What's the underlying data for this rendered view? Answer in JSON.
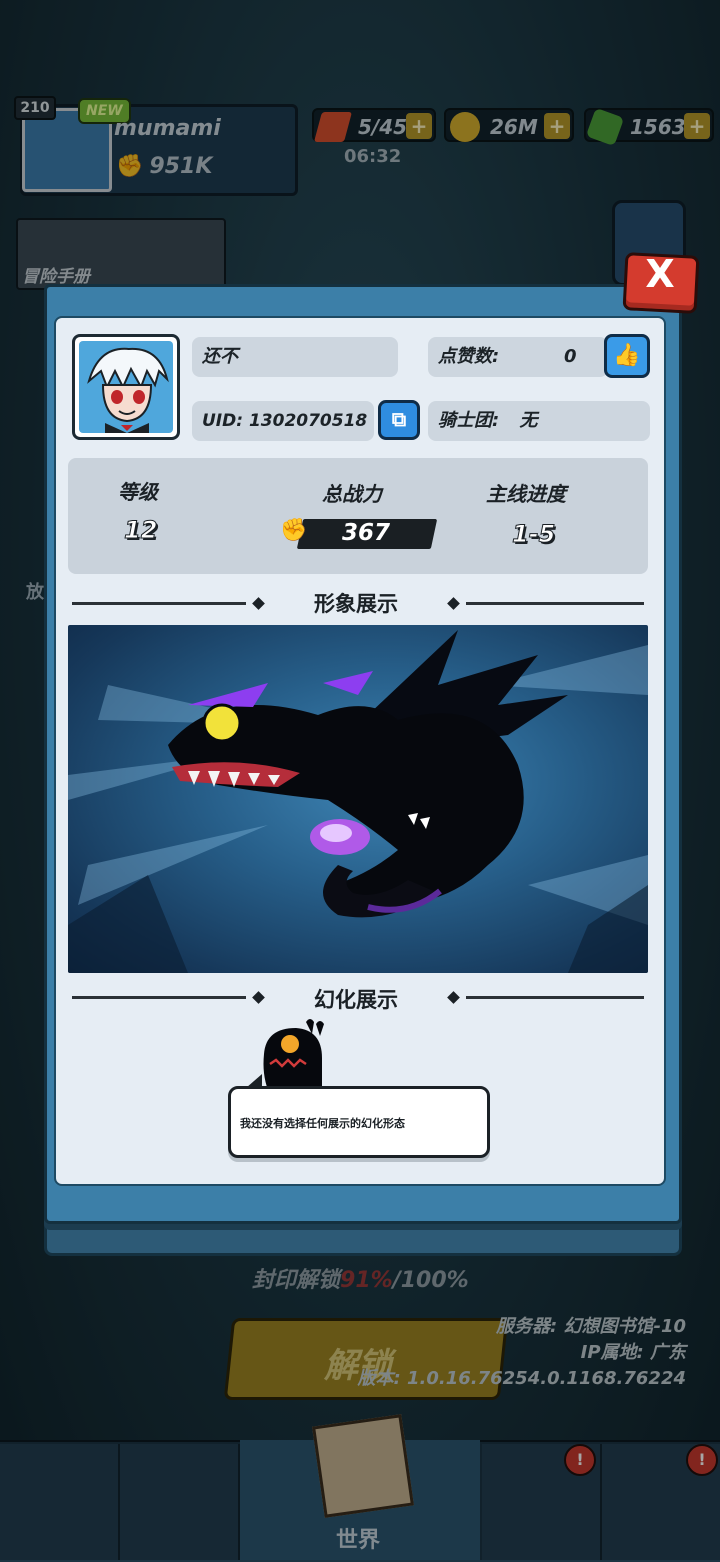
{
  "background": {
    "player": {
      "level": "210",
      "new_badge": "NEW",
      "name": "mumami",
      "power": "951K"
    },
    "resources": {
      "energy": "5/45",
      "energy_timer": "06:32",
      "gold": "26M",
      "gems": "1563"
    },
    "adventure_book": "冒险手册",
    "side_label": "放",
    "seal_unlock": {
      "prefix": "封印解锁",
      "percent": "91%",
      "total": "/100%"
    },
    "unlock_button": "解锁",
    "server_info": {
      "server": "服务器: 幻想图书馆-10",
      "ip": "IP属地: 广东",
      "version": "版本: 1.0.16.76254.0.1168.76224"
    },
    "bottom_nav": {
      "world_label": "世界",
      "badge_mark": "!"
    }
  },
  "profile": {
    "close_label": "X",
    "nickname": "还不",
    "likes_label": "点赞数:",
    "likes_value": "0",
    "uid_label": "UID: 1302070518",
    "guild_label": "骑士团:",
    "guild_value": "无",
    "stats": {
      "level_label": "等级",
      "level_value": "12",
      "power_label": "总战力",
      "power_value": "367",
      "progress_label": "主线进度",
      "progress_value": "1-5"
    },
    "appearance_title": "形象展示",
    "transform_title": "幻化展示",
    "transform_empty_text": "我还没有选择任何展示的幻化形态"
  },
  "colors": {
    "modal_border": "#3c7fa8",
    "panel_bg": "#e6edf4",
    "close_red": "#d43b2e",
    "button_blue": "#3a9be8",
    "dragon_eye": "#f2e23a",
    "dragon_horn": "#8d3ef0"
  },
  "icons": {
    "close": "close-icon",
    "like": "thumbs-up-icon",
    "copy": "copy-icon",
    "power": "fist-icon"
  }
}
